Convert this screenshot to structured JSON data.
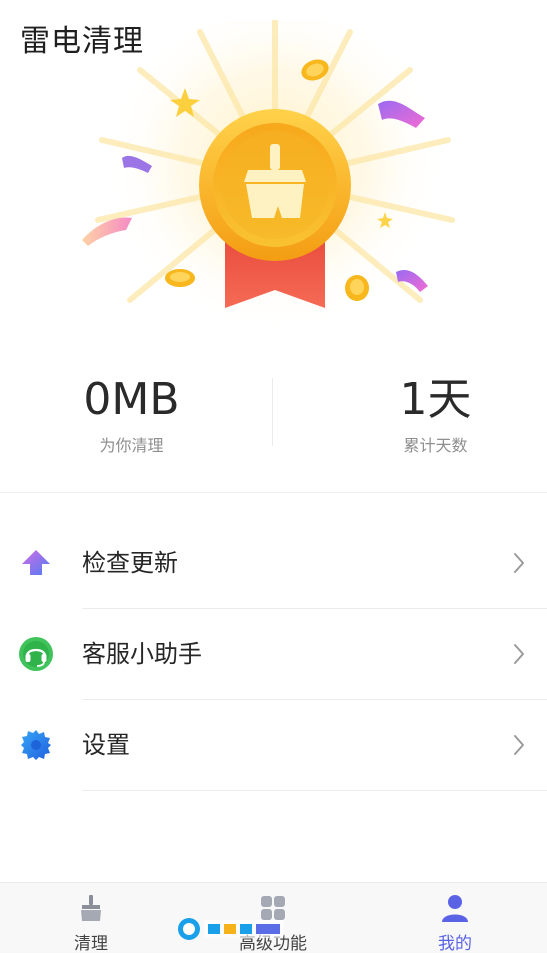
{
  "app": {
    "title": "雷电清理"
  },
  "stats": {
    "cleaned": {
      "value": "0MB",
      "label": "为你清理"
    },
    "days": {
      "value": "1天",
      "label": "累计天数"
    }
  },
  "menu": [
    {
      "label": "检查更新",
      "icon": "upload-arrow-icon"
    },
    {
      "label": "客服小助手",
      "icon": "headset-icon"
    },
    {
      "label": "设置",
      "icon": "gear-icon"
    }
  ],
  "tabs": [
    {
      "label": "清理",
      "icon": "broom-icon",
      "active": false
    },
    {
      "label": "高级功能",
      "icon": "grid-icon",
      "active": false
    },
    {
      "label": "我的",
      "icon": "user-icon",
      "active": true
    }
  ],
  "colors": {
    "accent": "#5a63e6",
    "medal_gold": "#f8b21c",
    "ribbon_red": "#f05a4a",
    "update_icon": "#6b6ff0",
    "service_icon": "#3fc35a",
    "settings_icon": "#2d8cf0"
  }
}
